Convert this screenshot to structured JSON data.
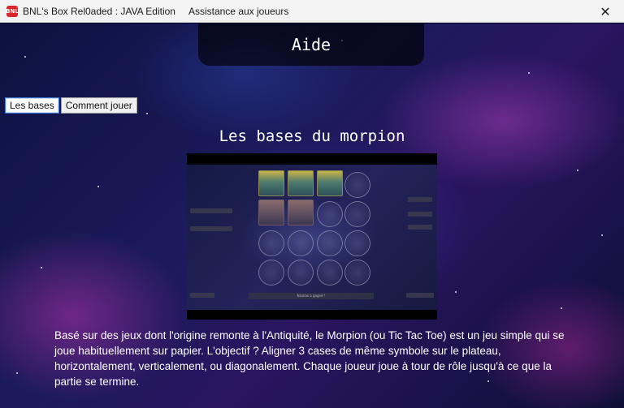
{
  "window": {
    "app_icon_text": "BNL",
    "title": "BNL's Box Rel0aded : JAVA Edition     Assistance aux joueurs",
    "close_glyph": "✕"
  },
  "header": {
    "title": "Aide"
  },
  "tabs": [
    {
      "label": "Les bases",
      "active": true
    },
    {
      "label": "Comment jouer",
      "active": false
    }
  ],
  "section": {
    "title": "Les bases du morpion",
    "preview_bar_text": "Nicolas a gagné !",
    "description": "Basé sur des jeux dont l'origine remonte à l'Antiquité, le Morpion (ou Tic Tac Toe) est un jeu simple qui se joue habituellement sur papier. L'objectif ? Aligner 3 cases de même symbole sur le plateau, horizontalement, verticalement, ou diagonalement. Chaque joueur joue à tour de rôle jusqu'à ce que la partie se termine."
  },
  "colors": {
    "titlebar_bg": "#f3f3f3",
    "accent_tab_border": "#3b78d8",
    "header_bg": "#000000"
  }
}
